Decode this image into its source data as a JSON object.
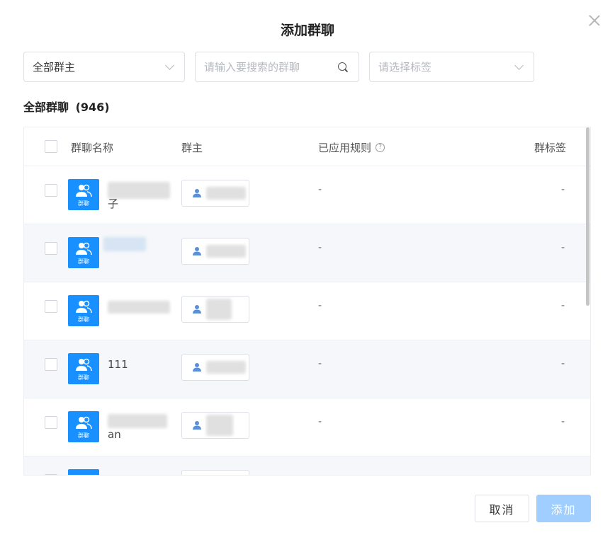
{
  "dialog": {
    "title": "添加群聊",
    "close_icon": "close-icon"
  },
  "filters": {
    "owner_select_value": "全部群主",
    "search_placeholder": "请输入要搜索的群聊",
    "tag_placeholder": "请选择标签"
  },
  "section": {
    "title": "全部群聊",
    "count": "(946)"
  },
  "table": {
    "headers": {
      "name": "群聊名称",
      "owner": "群主",
      "rule": "已应用规则",
      "tag": "群标签"
    },
    "rows": [
      {
        "avatar_label": "群聊",
        "name": "子",
        "rule": "-",
        "tag": "-"
      },
      {
        "avatar_label": "群聊",
        "name": "",
        "rule": "-",
        "tag": "-"
      },
      {
        "avatar_label": "群聊",
        "name": "",
        "rule": "-",
        "tag": "-"
      },
      {
        "avatar_label": "群聊",
        "name": "111",
        "rule": "-",
        "tag": "-"
      },
      {
        "avatar_label": "群聊",
        "name": "an",
        "rule": "-",
        "tag": "-"
      }
    ]
  },
  "footer": {
    "cancel_label": "取消",
    "add_label": "添加"
  },
  "colors": {
    "primary": "#1890ff",
    "primary_disabled": "#a0cfff"
  }
}
